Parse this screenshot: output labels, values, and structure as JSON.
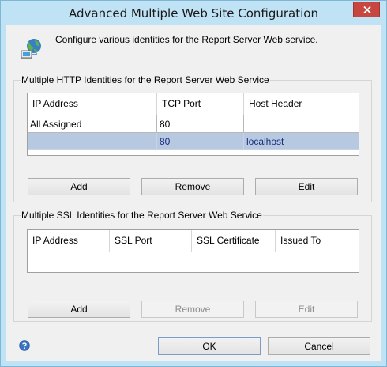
{
  "window": {
    "title": "Advanced Multiple Web Site Configuration",
    "close_glyph": "×"
  },
  "header": {
    "description": "Configure various identities for the Report Server Web service.",
    "icon": "globe-network-icon"
  },
  "http_section": {
    "legend": "Multiple HTTP Identities for the Report Server Web Service",
    "columns": [
      "IP Address",
      "TCP Port",
      "Host Header"
    ],
    "rows": [
      {
        "ip": "All Assigned",
        "port": "80",
        "host": ""
      },
      {
        "ip": "",
        "port": "80",
        "host": "localhost",
        "selected": true
      }
    ],
    "buttons": {
      "add": "Add",
      "remove": "Remove",
      "edit": "Edit"
    }
  },
  "ssl_section": {
    "legend": "Multiple SSL Identities for the Report Server Web Service",
    "columns": [
      "IP Address",
      "SSL Port",
      "SSL Certificate",
      "Issued To"
    ],
    "rows": [],
    "buttons": {
      "add": "Add",
      "remove": "Remove",
      "edit": "Edit"
    },
    "disabled": [
      "remove",
      "edit"
    ]
  },
  "footer": {
    "ok": "OK",
    "cancel": "Cancel",
    "help_icon": "help-icon"
  },
  "colors": {
    "frame": "#bfe2f5",
    "close": "#c7463f",
    "selected_row": "#b6c9e1"
  }
}
